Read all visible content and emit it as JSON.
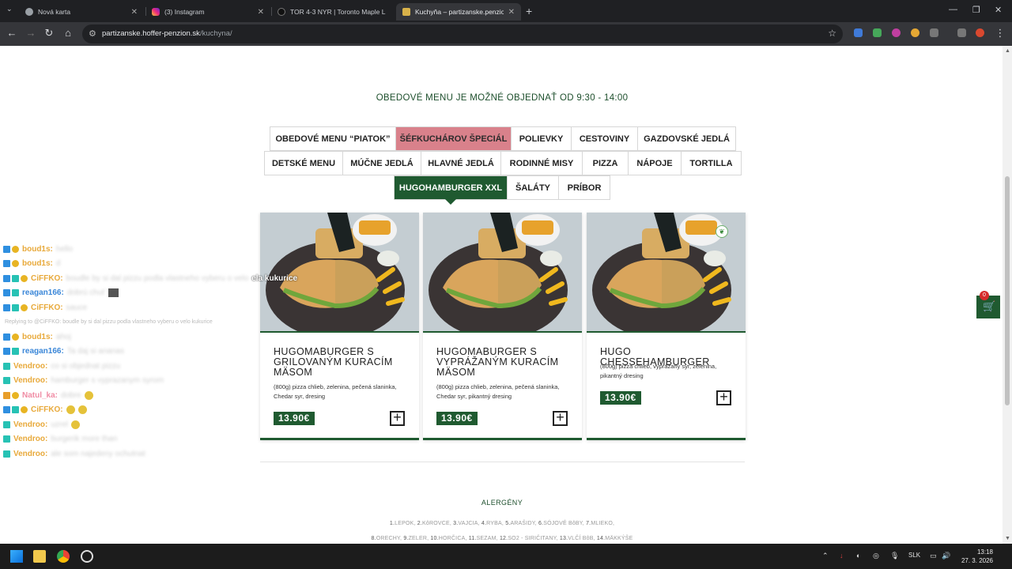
{
  "browser": {
    "tabs": [
      {
        "title": "Nová karta",
        "active": false
      },
      {
        "title": "(3) Instagram",
        "active": false
      },
      {
        "title": "TOR 4-3 NYR | Toronto Maple L",
        "active": false
      },
      {
        "title": "Kuchyňa – partizanske.penzion",
        "active": true
      }
    ],
    "url_host": "partizanske.hoffer-penzion.sk",
    "url_path": "/kuchyna/"
  },
  "page": {
    "order_note": "OBEDOVÉ MENU JE MOŽNÉ OBJEDNAŤ OD 9:30 - 14:00",
    "categories_row1": [
      "OBEDOVÉ MENU “PIATOK”",
      "ŠÉFKUCHÁROV ŠPECIÁL",
      "POLIEVKY",
      "CESTOVINY",
      "GAZDOVSKÉ JEDLÁ"
    ],
    "categories_row2": [
      "DETSKÉ MENU",
      "MÚČNE JEDLÁ",
      "HLAVNÉ JEDLÁ",
      "RODINNÉ MISY",
      "PIZZA",
      "NÁPOJE",
      "TORTILLA"
    ],
    "categories_row3": [
      "HUGOHAMBURGER XXL",
      "ŠALÁTY",
      "PRÍBOR"
    ],
    "products": [
      {
        "name": "HUGOMABURGER S GRILOVANÝM KURACÍM MÄSOM",
        "desc": "(800g) pizza chlieb, zelenina, pečená slaninka, Chedar syr, dresing",
        "price": "13.90€"
      },
      {
        "name": "HUGOMABURGER S VYPRÁŽANÝM KURACÍM MÄSOM",
        "desc": "(800g) pizza chlieb, zelenina, pečená slaninka, Chedar syr, pikantný dresing",
        "price": "13.90€"
      },
      {
        "name": "HUGO CHESSEHAMBURGER",
        "desc": "(800g) pizza chlieb, vyprážaný syr, zelenina, pikantný dresing",
        "price": "13.90€"
      }
    ],
    "allergens_title": "ALERGÉNY",
    "allergens_line1": [
      {
        "n": "1.",
        "t": "LEPOK, "
      },
      {
        "n": "2.",
        "t": "KôROVCE, "
      },
      {
        "n": "3.",
        "t": "VAJCIA, "
      },
      {
        "n": "4.",
        "t": "RYBA, "
      },
      {
        "n": "5.",
        "t": "ARAŠIDY, "
      },
      {
        "n": "6.",
        "t": "SÓJOVÉ BôBY, "
      },
      {
        "n": "7.",
        "t": "MLIEKO,"
      }
    ],
    "allergens_line2": [
      {
        "n": "8.",
        "t": "ORECHY, "
      },
      {
        "n": "9.",
        "t": "ZELER, "
      },
      {
        "n": "10.",
        "t": "HORČICA, "
      },
      {
        "n": "11.",
        "t": "SEZAM, "
      },
      {
        "n": "12.",
        "t": "SO2 - SIRIČITANY, "
      },
      {
        "n": "13.",
        "t": "VLČÍ BôB, "
      },
      {
        "n": "14.",
        "t": "MÄKKÝŠE"
      }
    ],
    "cart_count": "0"
  },
  "chat": [
    {
      "icons": [
        "blue",
        "gold"
      ],
      "user": "boud1s:",
      "color": "#e8a93a",
      "msg": "hello"
    },
    {
      "icons": [
        "blue",
        "gold"
      ],
      "user": "boud1s:",
      "color": "#e8a93a",
      "msg": "d"
    },
    {
      "icons": [
        "blue",
        "teal",
        "gold"
      ],
      "user": "CiFFKO:",
      "color": "#e8a93a",
      "msg": "boudle by si dal pizzu podla vlastneho vyberu o velo",
      "tail": "ela kukurice"
    },
    {
      "icons": [
        "blue",
        "teal"
      ],
      "user": "reagan166:",
      "color": "#3b87d8",
      "msg": "dobrú chuť",
      "emote": true
    },
    {
      "icons": [
        "blue",
        "teal",
        "gold"
      ],
      "user": "CiFFKO:",
      "color": "#e8a93a",
      "msg": "sauce"
    },
    {
      "reply": "Replying to @CiFFKO: boudle by si dal pizzu podla vlastneho vyberu o velo kukurice"
    },
    {
      "icons": [
        "blue",
        "gold"
      ],
      "user": "boud1s:",
      "color": "#e8a93a",
      "msg": "ahoj"
    },
    {
      "icons": [
        "blue",
        "teal"
      ],
      "user": "reagan166:",
      "color": "#3b87d8",
      "msg": "Ta daj si ananas"
    },
    {
      "icons": [
        "teal"
      ],
      "user": "Vendroo:",
      "color": "#e8a93a",
      "msg": "co si objednat pizzu"
    },
    {
      "icons": [
        "teal"
      ],
      "user": "Vendroo:",
      "color": "#e8a93a",
      "msg": "hamburger s vyprazanym syrom"
    },
    {
      "icons": [
        "orange",
        "gold"
      ],
      "user": "Natul_ka:",
      "color": "#f08ca4",
      "msg": "dobre",
      "emoji": 1
    },
    {
      "icons": [
        "blue",
        "teal",
        "gold"
      ],
      "user": "CiFFKO:",
      "color": "#e8a93a",
      "msg": "",
      "emoji": 2
    },
    {
      "icons": [
        "teal"
      ],
      "user": "Vendroo:",
      "color": "#e8a93a",
      "msg": "uzrel",
      "emoji": 1
    },
    {
      "icons": [
        "teal"
      ],
      "user": "Vendroo:",
      "color": "#e8a93a",
      "msg": "burgerik more than"
    },
    {
      "icons": [
        "teal"
      ],
      "user": "Vendroo:",
      "color": "#e8a93a",
      "msg": "ale som najedeny ochutnat"
    }
  ],
  "taskbar": {
    "lang": "SLK",
    "time": "13:18",
    "date": "27. 3. 2026"
  }
}
